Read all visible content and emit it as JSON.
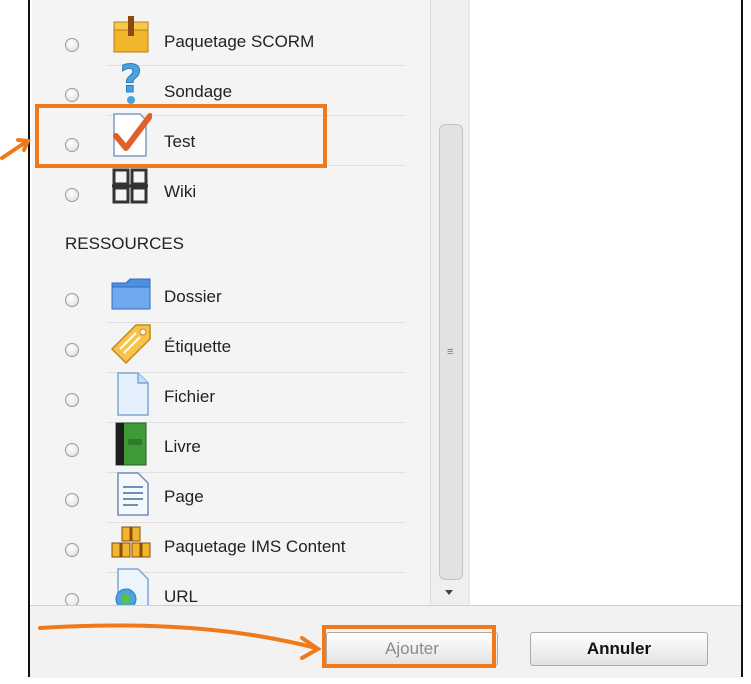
{
  "activities": [
    {
      "label": "Paquetage SCORM",
      "icon": "scorm-package-icon"
    },
    {
      "label": "Sondage",
      "icon": "question-mark-icon"
    },
    {
      "label": "Test",
      "icon": "quiz-checkmark-icon"
    },
    {
      "label": "Wiki",
      "icon": "wiki-icon"
    }
  ],
  "resources_heading": "RESSOURCES",
  "resources": [
    {
      "label": "Dossier",
      "icon": "folder-icon"
    },
    {
      "label": "Étiquette",
      "icon": "label-tag-icon"
    },
    {
      "label": "Fichier",
      "icon": "file-icon"
    },
    {
      "label": "Livre",
      "icon": "book-icon"
    },
    {
      "label": "Page",
      "icon": "page-icon"
    },
    {
      "label": "Paquetage IMS Content",
      "icon": "ims-package-icon"
    },
    {
      "label": "URL",
      "icon": "url-globe-icon"
    }
  ],
  "footer": {
    "add_label": "Ajouter",
    "cancel_label": "Annuler"
  },
  "colors": {
    "highlight": "#f07a1a",
    "panel_bg": "#f4f4f4"
  }
}
